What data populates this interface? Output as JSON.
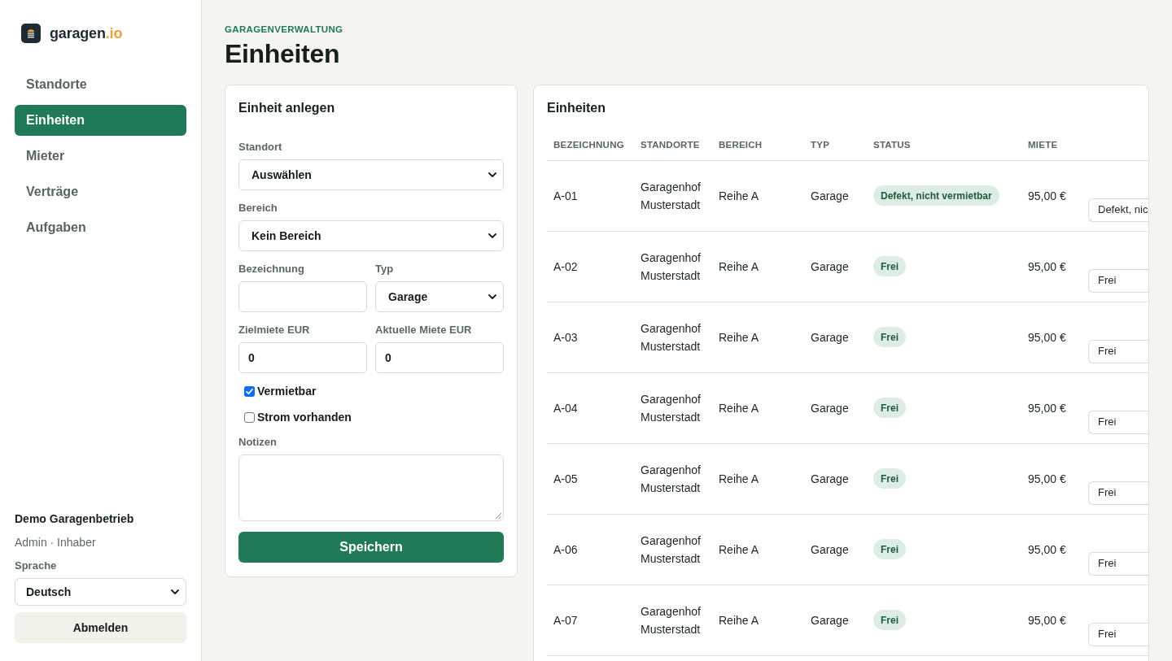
{
  "sidebar": {
    "brand": {
      "name": "garagen",
      "suffix": ".io"
    },
    "nav": [
      {
        "label": "Standorte",
        "selected": false
      },
      {
        "label": "Einheiten",
        "selected": true
      },
      {
        "label": "Mieter",
        "selected": false
      },
      {
        "label": "Verträge",
        "selected": false
      },
      {
        "label": "Aufgaben",
        "selected": false
      }
    ],
    "account": {
      "organization": "Demo Garagenbetrieb",
      "role": "Admin · Inhaber",
      "language_label": "Sprache",
      "language": "Deutsch",
      "logout": "Abmelden"
    }
  },
  "header": {
    "eyebrow": "GARAGENVERWALTUNG",
    "title": "Einheiten"
  },
  "form": {
    "title": "Einheit anlegen",
    "field_rows": [
      {
        "fields": [
          {
            "label": "Standort",
            "kind": "select",
            "value": "Auswählen"
          }
        ]
      },
      {
        "fields": [
          {
            "label": "Bereich",
            "kind": "select",
            "value": "Kein Bereich"
          }
        ]
      },
      {
        "fields": [
          {
            "label": "Bezeichnung",
            "kind": "input"
          },
          {
            "label": "Typ",
            "kind": "select",
            "value": "Garage"
          }
        ]
      },
      {
        "fields": [
          {
            "label": "Zielmiete EUR",
            "kind": "input",
            "value": "0"
          },
          {
            "label": "Aktuelle Miete EUR",
            "kind": "input",
            "value": "0"
          }
        ]
      }
    ],
    "checkboxes": [
      {
        "label": "Vermietbar",
        "checked": true
      },
      {
        "label": "Strom vorhanden",
        "checked": false
      }
    ],
    "notes": {
      "label": "Notizen"
    },
    "submit": "Speichern"
  },
  "table": {
    "title": "Einheiten",
    "columns": [
      "BEZEICHNUNG",
      "STANDORTE",
      "BEREICH",
      "TYP",
      "STATUS",
      "MIETE"
    ],
    "rows": [
      {
        "bezeichnung": "A-01",
        "standort": "Garagenhof Musterstadt",
        "bereich": "Reihe A",
        "typ": "Garage",
        "status": "Defekt, nicht vermietbar",
        "miete": "95,00 €",
        "status_select": "Defekt, nic"
      },
      {
        "bezeichnung": "A-02",
        "standort": "Garagenhof Musterstadt",
        "bereich": "Reihe A",
        "typ": "Garage",
        "status": "Frei",
        "miete": "95,00 €",
        "status_select": "Frei"
      },
      {
        "bezeichnung": "A-03",
        "standort": "Garagenhof Musterstadt",
        "bereich": "Reihe A",
        "typ": "Garage",
        "status": "Frei",
        "miete": "95,00 €",
        "status_select": "Frei"
      },
      {
        "bezeichnung": "A-04",
        "standort": "Garagenhof Musterstadt",
        "bereich": "Reihe A",
        "typ": "Garage",
        "status": "Frei",
        "miete": "95,00 €",
        "status_select": "Frei"
      },
      {
        "bezeichnung": "A-05",
        "standort": "Garagenhof Musterstadt",
        "bereich": "Reihe A",
        "typ": "Garage",
        "status": "Frei",
        "miete": "95,00 €",
        "status_select": "Frei"
      },
      {
        "bezeichnung": "A-06",
        "standort": "Garagenhof Musterstadt",
        "bereich": "Reihe A",
        "typ": "Garage",
        "status": "Frei",
        "miete": "95,00 €",
        "status_select": "Frei"
      },
      {
        "bezeichnung": "A-07",
        "standort": "Garagenhof Musterstadt",
        "bereich": "Reihe A",
        "typ": "Garage",
        "status": "Frei",
        "miete": "95,00 €",
        "status_select": "Frei"
      }
    ]
  }
}
